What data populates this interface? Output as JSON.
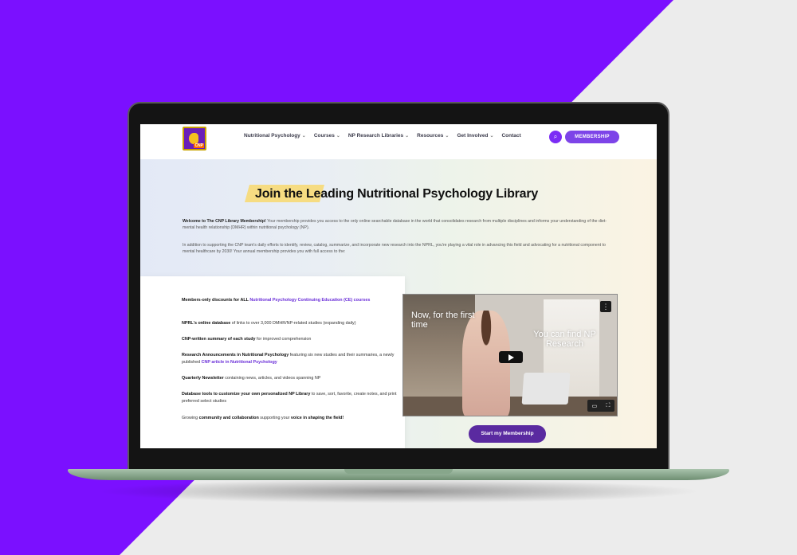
{
  "header": {
    "logo_text": "CNP",
    "nav": [
      {
        "label": "Nutritional Psychology"
      },
      {
        "label": "Courses"
      },
      {
        "label": "NP Research Libraries"
      },
      {
        "label": "Resources"
      },
      {
        "label": "Get Involved"
      },
      {
        "label": "Contact"
      }
    ],
    "membership_label": "MEMBERSHIP"
  },
  "hero": {
    "title": "Join the Leading Nutritional Psychology Library",
    "intro_bold": "Welcome to The CNP Library Membership!",
    "intro_rest": " Your membership provides you access to the only online searchable database in the world that consolidates research from multiple disciplines and informs your understanding of the diet-mental health relationship (DMHR) within nutritional psychology (NP).",
    "intro2": "In addition to supporting the CNP team's daily efforts to identify, review, catalog, summarize, and incorporate new research into the NPRL, you're playing a vital role in advancing this field and advocating for a nutritional component to mental healthcare by 2030! Your annual membership provides you with full access to the:"
  },
  "benefits": {
    "b1_a": "Members-only discounts for ALL ",
    "b1_link": "Nutritional Psychology Continuing Education (CE) courses",
    "b2_bold": "NPRL's online database",
    "b2_rest": " of links to over 3,000 DMHR/NP-related studies (expanding daily)",
    "b3_bold": "CNP-written summary of each study",
    "b3_rest": " for improved comprehension",
    "b4_bold": "Research Announcements in Nutritional Psychology",
    "b4_rest": " featuring six new studies and their summaries, a newly published ",
    "b4_link": "CNP article in Nutritional Psychology",
    "b5_bold": "Quarterly Newsletter",
    "b5_rest": " containing news, articles, and videos spanning NP",
    "b6_bold": "Database tools to customize your own personalized NP Library",
    "b6_rest": " to save, sort, favorite, create notes, and print preferred select studies",
    "b7_a": "Growing ",
    "b7_bold": "community and collaboration",
    "b7_b": " supporting your ",
    "b7_bold2": "voice in shaping the field!"
  },
  "video": {
    "text_left": "Now, for the first time",
    "text_right": "You can find NP Research"
  },
  "cta": {
    "label": "Start my Membership"
  },
  "colors": {
    "accent": "#7b10ff",
    "button": "#5a2aa0",
    "highlight": "#f6dc82"
  }
}
